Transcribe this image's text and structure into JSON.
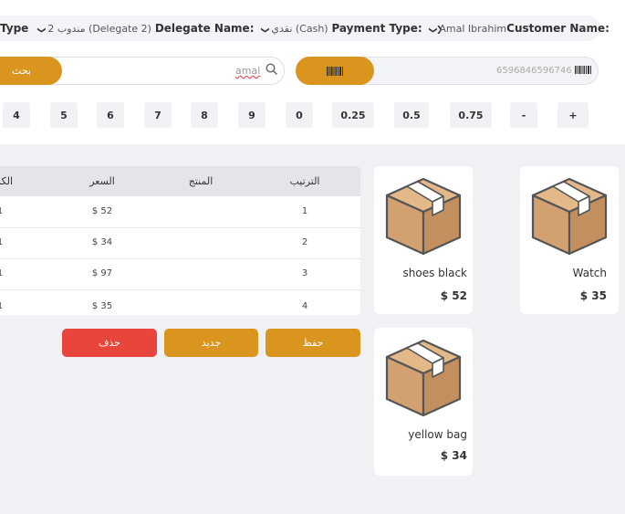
{
  "header": {
    "customer_label": "Customer Name:",
    "customer_value": "Amal Ibrahim",
    "payment_label": "Payment Type:",
    "payment_value": "نقدي (Cash)",
    "delegate_label": "Delegate Name:",
    "delegate_value": "مندوب 2 (Delegate 2)",
    "type_label": "Type"
  },
  "search": {
    "value": "amal",
    "button_label": "بحث"
  },
  "barcode": {
    "value": "6596846596746"
  },
  "keypad": [
    "+",
    "-",
    "0.75",
    "0.5",
    "0.25",
    "0",
    "9",
    "8",
    "7",
    "6",
    "5",
    "4"
  ],
  "table": {
    "headers": [
      "الترتيب",
      "المنتج",
      "السعر",
      "الكمية"
    ],
    "rows": [
      {
        "order": "1",
        "product": "",
        "price": "$ 52",
        "qty": "1"
      },
      {
        "order": "2",
        "product": "",
        "price": "$ 34",
        "qty": "1"
      },
      {
        "order": "3",
        "product": "",
        "price": "$ 97",
        "qty": "1"
      },
      {
        "order": "4",
        "product": "",
        "price": "$ 35",
        "qty": "1"
      }
    ]
  },
  "actions": {
    "save": "حفظ",
    "new": "جديد",
    "delete": "حذف"
  },
  "products": [
    {
      "name": "Watch",
      "price": "$ 35"
    },
    {
      "name": "shoes black",
      "price": "$ 52"
    },
    {
      "name": "yellow bag",
      "price": "$ 34"
    }
  ],
  "colors": {
    "accent": "#d9951e",
    "danger": "#e8453c",
    "background": "#f0f1f5"
  }
}
